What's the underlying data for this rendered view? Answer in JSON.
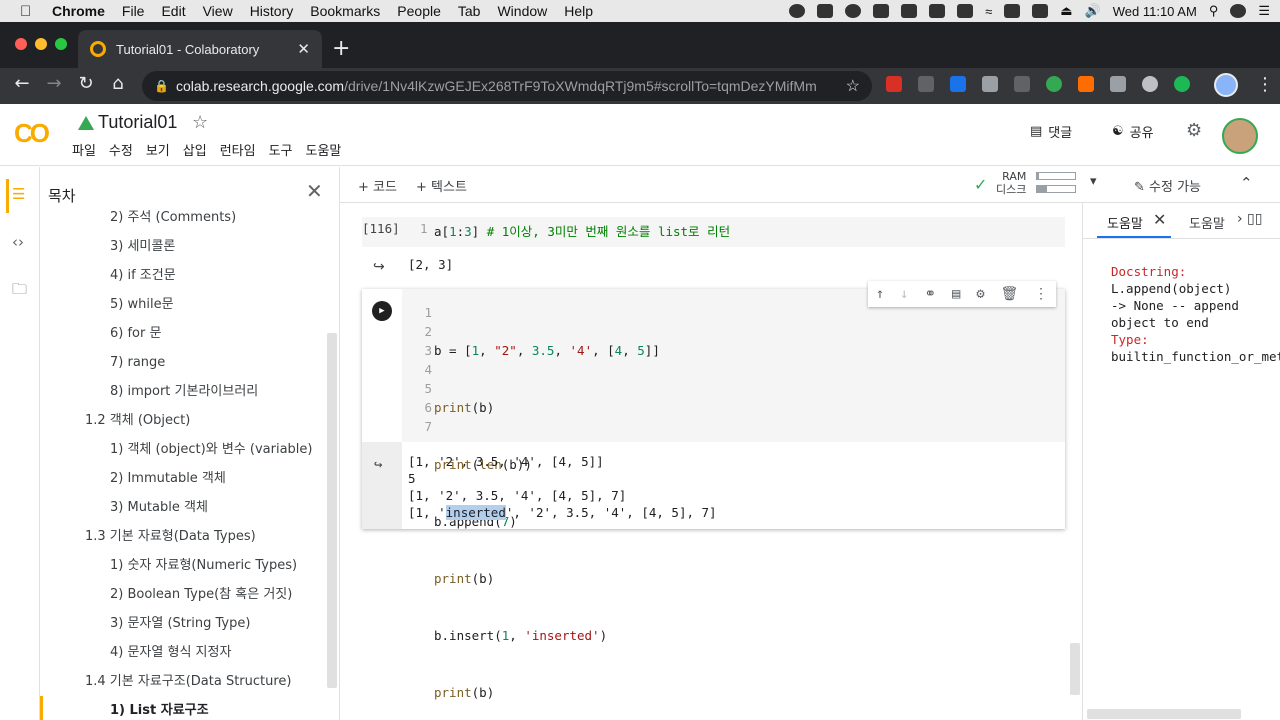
{
  "mac_menubar": {
    "app": "Chrome",
    "menus": [
      "File",
      "Edit",
      "View",
      "History",
      "Bookmarks",
      "People",
      "Tab",
      "Window",
      "Help"
    ],
    "clock": "Wed 11:10 AM"
  },
  "browser": {
    "tab_title": "Tutorial01 - Colaboratory",
    "url_host": "colab.research.google.com",
    "url_path": "/drive/1Nv4lKzwGEJEx268TrF9ToXWmdqRTj9m5#scrollTo=tqmDezYMifMm"
  },
  "colab": {
    "doc_title": "Tutorial01",
    "menus": [
      "파일",
      "수정",
      "보기",
      "삽입",
      "런타임",
      "도구",
      "도움말"
    ],
    "comment_label": "댓글",
    "share_label": "공유"
  },
  "toc": {
    "title": "목차",
    "items": [
      {
        "label": "2) 주석 (Comments)",
        "level": 2
      },
      {
        "label": "3) 세미콜론",
        "level": 2
      },
      {
        "label": "4) if 조건문",
        "level": 2
      },
      {
        "label": "5) while문",
        "level": 2
      },
      {
        "label": "6) for 문",
        "level": 2
      },
      {
        "label": "7) range",
        "level": 2
      },
      {
        "label": "8) import 기본라이브러리",
        "level": 2
      },
      {
        "label": "1.2 객체 (Object)",
        "level": 1
      },
      {
        "label": "1) 객체 (object)와 변수 (variable)",
        "level": 2
      },
      {
        "label": "2) Immutable 객체",
        "level": 2
      },
      {
        "label": "3) Mutable 객체",
        "level": 2
      },
      {
        "label": "1.3 기본 자료형(Data Types)",
        "level": 1
      },
      {
        "label": "1) 숫자 자료형(Numeric Types)",
        "level": 2
      },
      {
        "label": "2) Boolean Type(참 혹은 거짓)",
        "level": 2
      },
      {
        "label": "3) 문자열 (String Type)",
        "level": 2
      },
      {
        "label": "4) 문자열 형식 지정자",
        "level": 2
      },
      {
        "label": "1.4 기본 자료구조(Data Structure)",
        "level": 1
      },
      {
        "label": "1) List 자료구조",
        "level": 2
      }
    ]
  },
  "toolbar": {
    "add_code": "+ 코드",
    "add_text": "+ 텍스트",
    "ram_label": "RAM",
    "disk_label": "디스크",
    "ram_usage": 0.05,
    "disk_usage": 0.25,
    "edit_mode": "수정 가능"
  },
  "cells": {
    "cell1": {
      "exec_count": "[116]",
      "line_number": "1",
      "code_a": "a[",
      "code_n1": "1",
      "code_b": ":",
      "code_n2": "3",
      "code_c": "] ",
      "code_comment": "# 1이상, 3미만 번째 원소를 list로 리턴",
      "output": "[2, 3]"
    },
    "cell2": {
      "line_numbers": [
        "1",
        "2",
        "3",
        "4",
        "5",
        "6",
        "7"
      ],
      "outputs": [
        "[1, '2', 3.5, '4', [4, 5]]",
        "5",
        "[1, '2', 3.5, '4', [4, 5], 7]"
      ],
      "out4_pre": "[1, '",
      "out4_sel": "inserted",
      "out4_post": "', '2', 3.5, '4', [4, 5], 7]"
    }
  },
  "help": {
    "tab1": "도움말",
    "tab2": "도움말",
    "docstring_key": "Docstring:",
    "docstring_line1": "L.append(object)",
    "docstring_line2": "-> None -- append",
    "docstring_line3": "object to end",
    "type_key": "Type:",
    "type_value": "builtin_function_or_method"
  }
}
